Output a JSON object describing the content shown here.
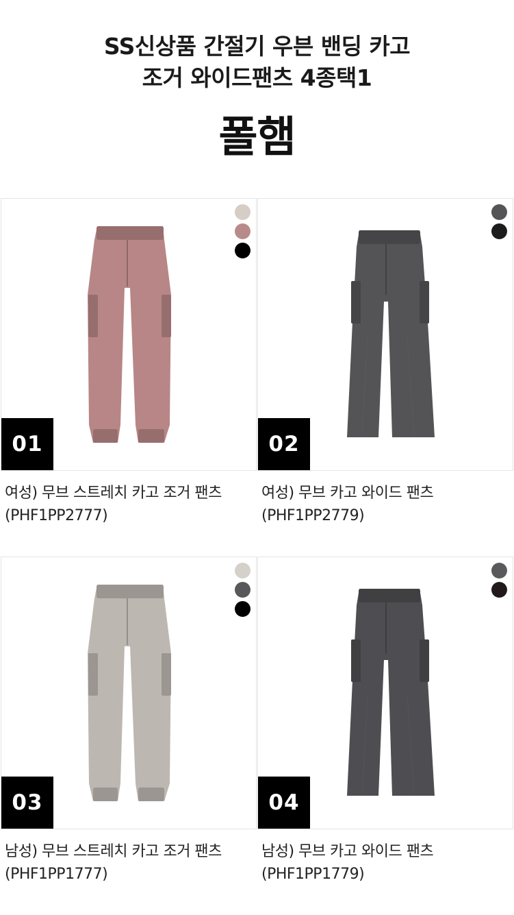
{
  "header": {
    "title_line1": "SS신상품 간절기 우븐 밴딩 카고",
    "title_line2": "조거 와이드팬츠 4종택1",
    "brand": "폴햄"
  },
  "products": [
    {
      "badge": "01",
      "name": "여성) 무브 스트레치 카고 조거 팬츠",
      "code": "(PHF1PP2777)",
      "swatches": [
        "#d5cdc6",
        "#b88b8b",
        "#000000"
      ],
      "pants_color": "#b88686",
      "style": "jogger"
    },
    {
      "badge": "02",
      "name": "여성) 무브 카고 와이드 팬츠",
      "code": "(PHF1PP2779)",
      "swatches": [
        "#555558",
        "#1c1c1c"
      ],
      "pants_color": "#545457",
      "style": "wide"
    },
    {
      "badge": "03",
      "name": "남성) 무브 스트레치 카고 조거 팬츠",
      "code": "(PHF1PP1777)",
      "swatches": [
        "#d6d0ca",
        "#58585a",
        "#000000"
      ],
      "pants_color": "#bdb7b1",
      "style": "jogger"
    },
    {
      "badge": "04",
      "name": "남성) 무브 카고 와이드 팬츠",
      "code": "(PHF1PP1779)",
      "swatches": [
        "#5a5a5c",
        "#221a1a"
      ],
      "pants_color": "#4e4e52",
      "style": "wide"
    }
  ]
}
